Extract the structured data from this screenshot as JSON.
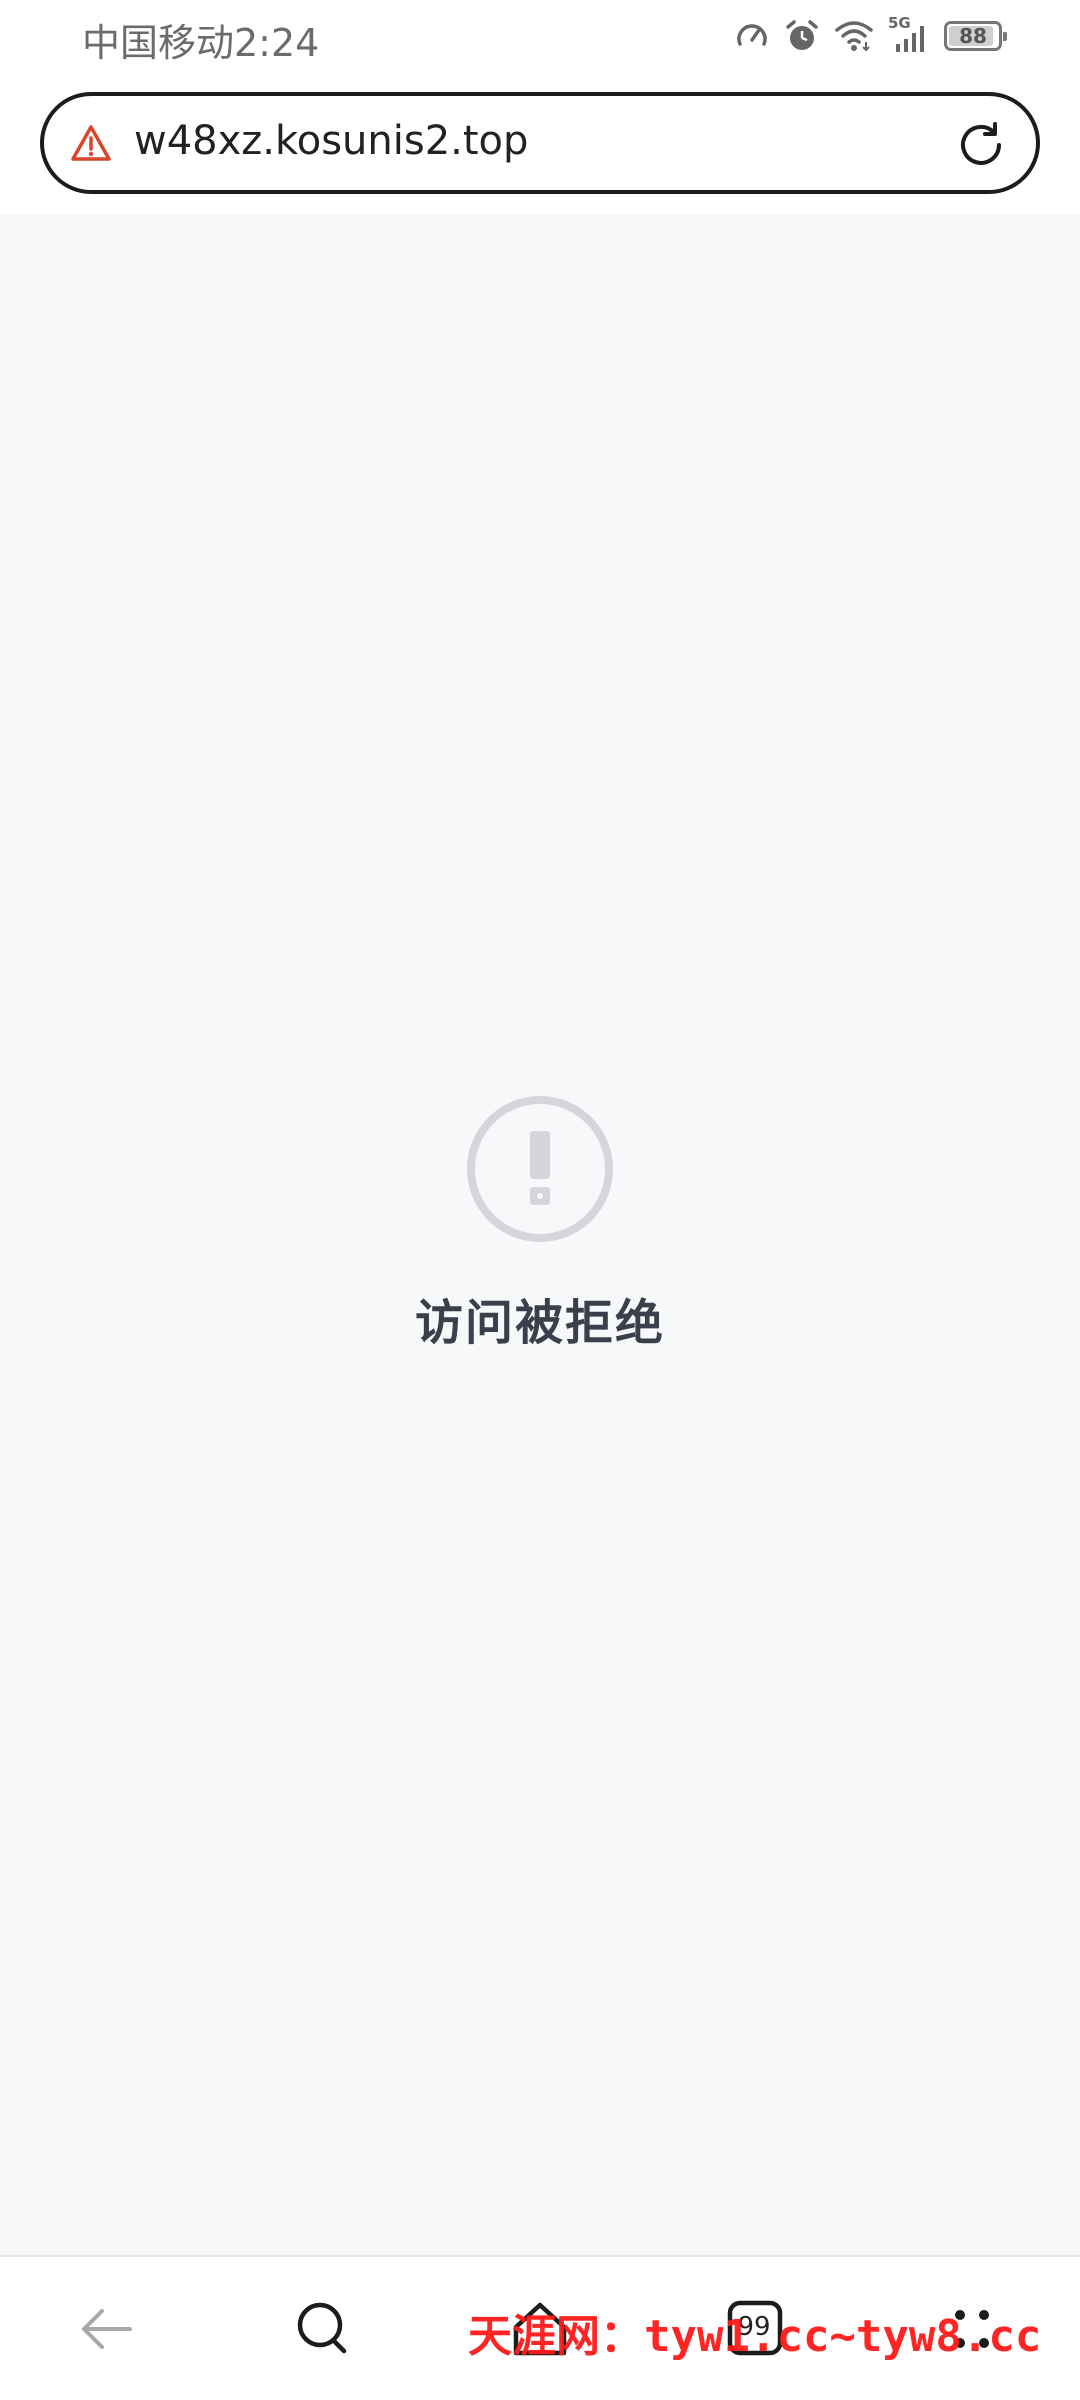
{
  "status_bar": {
    "carrier_time": "中国移动2:24",
    "network": "5G",
    "battery": "88",
    "icons": [
      "speed-icon",
      "alarm-icon",
      "wifi-icon",
      "signal-icon",
      "battery-icon"
    ]
  },
  "address_bar": {
    "url": "w48xz.kosunis2.top",
    "security_icon": "warning-icon",
    "action_icon": "reload-icon",
    "warning_color": "#d9452c"
  },
  "error_page": {
    "title": "访问被拒绝",
    "icon": "exclamation-circle-icon"
  },
  "bottom_nav": {
    "items": [
      "back-icon",
      "search-icon",
      "home-icon",
      "tabs-icon",
      "menu-icon"
    ],
    "tab_count": "99"
  },
  "watermark": {
    "text": "天涯网：tyw1.cc~tyw8.cc",
    "color": "#ff1a1a"
  }
}
